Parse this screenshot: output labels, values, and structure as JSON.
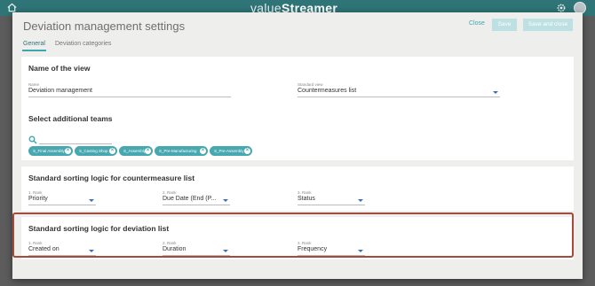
{
  "app_bar": {
    "logo_prefix": "value",
    "logo_suffix": "Streamer"
  },
  "dialog": {
    "title": "Deviation management settings",
    "close_label": "Close",
    "save_label": "Save",
    "save_close_label": "Save and close"
  },
  "tabs": [
    {
      "label": "General",
      "active": true
    },
    {
      "label": "Deviation categories",
      "active": false
    }
  ],
  "name_section": {
    "title": "Name of the view",
    "name_label": "Name",
    "name_value": "Deviation management",
    "standard_view_label": "Standard view",
    "standard_view_value": "Countermeasures list"
  },
  "teams_section": {
    "title": "Select additional teams",
    "chips": [
      "S_Final Assembly",
      "S_Casting Shop",
      "S_Assembly",
      "S_Pre-Manufacturing",
      "S_Pre-Assembly"
    ]
  },
  "countermeasure_sort": {
    "title": "Standard sorting logic for countermeasure list",
    "ranks": [
      {
        "label": "1. Rank",
        "value": "Priority"
      },
      {
        "label": "2. Rank",
        "value": "Due Date (End (P..."
      },
      {
        "label": "3. Rank",
        "value": "Status"
      }
    ]
  },
  "deviation_sort": {
    "title": "Standard sorting logic for deviation list",
    "ranks": [
      {
        "label": "1. Rank",
        "value": "Created on"
      },
      {
        "label": "2. Rank",
        "value": "Duration"
      },
      {
        "label": "3. Rank",
        "value": "Frequency"
      }
    ]
  },
  "colors": {
    "accent": "#3da7b1",
    "highlight": "#a24a3c"
  }
}
